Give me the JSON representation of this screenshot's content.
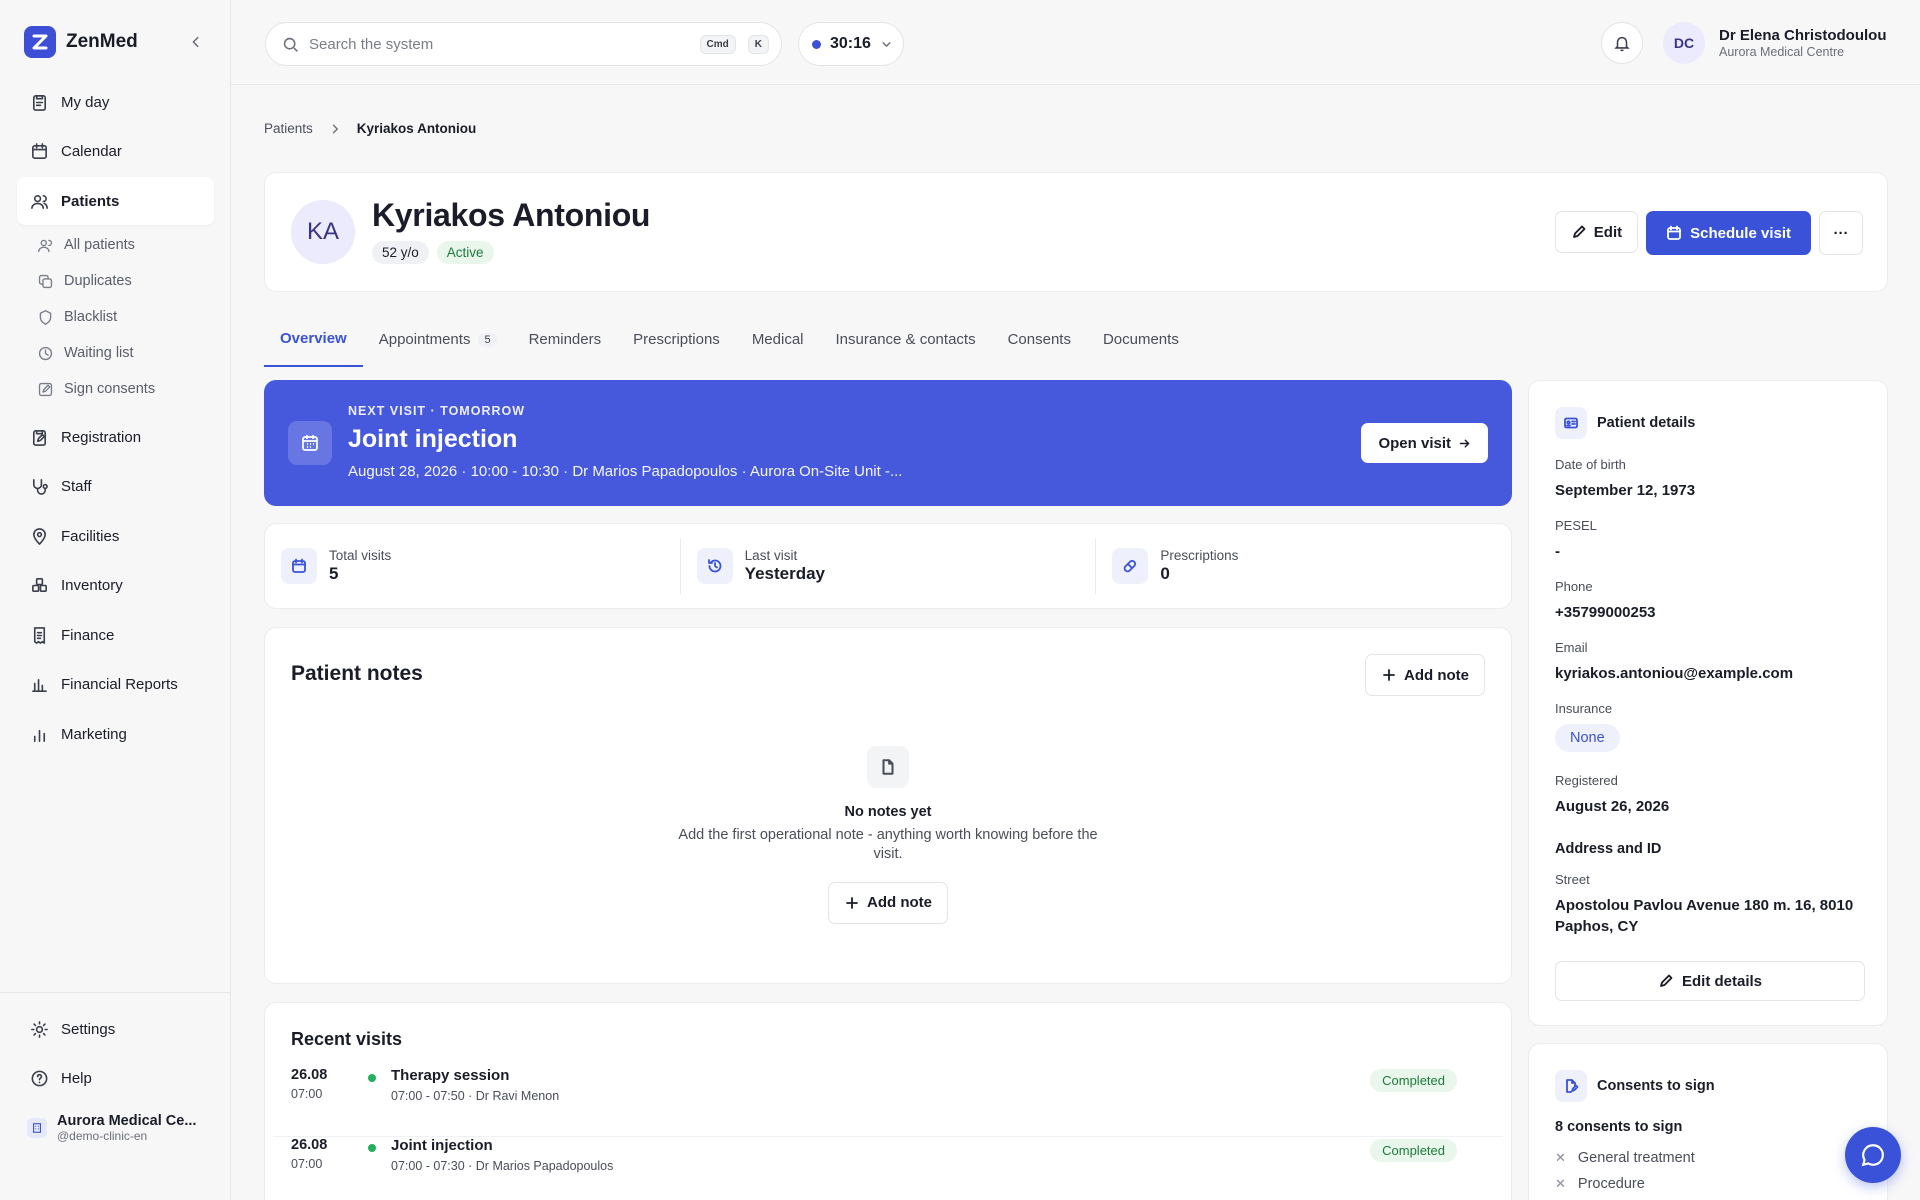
{
  "app": {
    "name": "ZenMed"
  },
  "sidebar": {
    "items": [
      {
        "label": "My day",
        "icon": "clipboard-icon"
      },
      {
        "label": "Calendar",
        "icon": "calendar-icon"
      },
      {
        "label": "Patients",
        "icon": "users-icon",
        "active": true
      },
      {
        "label": "Registration",
        "icon": "clipboard-edit-icon"
      },
      {
        "label": "Staff",
        "icon": "stethoscope-icon"
      },
      {
        "label": "Facilities",
        "icon": "map-pin-icon"
      },
      {
        "label": "Inventory",
        "icon": "boxes-icon"
      },
      {
        "label": "Finance",
        "icon": "receipt-icon"
      },
      {
        "label": "Financial Reports",
        "icon": "bar-chart-icon"
      },
      {
        "label": "Marketing",
        "icon": "signal-icon"
      }
    ],
    "patients_sub": [
      {
        "label": "All patients",
        "icon": "user-icon"
      },
      {
        "label": "Duplicates",
        "icon": "copy-icon"
      },
      {
        "label": "Blacklist",
        "icon": "shield-icon"
      },
      {
        "label": "Waiting list",
        "icon": "clock-icon"
      },
      {
        "label": "Sign consents",
        "icon": "pen-square-icon"
      }
    ],
    "settings_label": "Settings",
    "help_label": "Help",
    "clinic_name": "Aurora Medical Ce...",
    "clinic_handle": "@demo-clinic-en"
  },
  "topbar": {
    "search_placeholder": "Search the system",
    "shortcut_cmd": "Cmd",
    "shortcut_k": "K",
    "timer": "30:16",
    "user_initials": "DC",
    "user_name": "Dr Elena Christodoulou",
    "user_org": "Aurora Medical Centre"
  },
  "breadcrumb": {
    "parent": "Patients",
    "current": "Kyriakos Antoniou"
  },
  "patient": {
    "initials": "KA",
    "name": "Kyriakos Antoniou",
    "age": "52 y/o",
    "status": "Active",
    "edit_label": "Edit",
    "schedule_label": "Schedule visit",
    "more_label": "···"
  },
  "tabs": [
    {
      "label": "Overview",
      "active": true
    },
    {
      "label": "Appointments",
      "count": "5"
    },
    {
      "label": "Reminders"
    },
    {
      "label": "Prescriptions"
    },
    {
      "label": "Medical"
    },
    {
      "label": "Insurance & contacts"
    },
    {
      "label": "Consents"
    },
    {
      "label": "Documents"
    }
  ],
  "next_visit": {
    "label": "NEXT VISIT · TOMORROW",
    "title": "Joint injection",
    "meta": "August 28, 2026 · 10:00 - 10:30 · Dr Marios Papadopoulos · Aurora On-Site Unit -...",
    "button": "Open visit"
  },
  "stats": [
    {
      "label": "Total visits",
      "value": "5",
      "icon": "calendar-icon"
    },
    {
      "label": "Last visit",
      "value": "Yesterday",
      "icon": "history-icon"
    },
    {
      "label": "Prescriptions",
      "value": "0",
      "icon": "pill-icon"
    }
  ],
  "notes": {
    "title": "Patient notes",
    "add_label": "Add note",
    "empty_title": "No notes yet",
    "empty_desc": "Add the first operational note - anything worth knowing before the visit.",
    "empty_button": "Add note"
  },
  "recent": {
    "title": "Recent visits",
    "visits": [
      {
        "date": "26.08",
        "time": "07:00",
        "title": "Therapy session",
        "meta": "07:00 - 07:50 · Dr Ravi Menon",
        "status": "Completed"
      },
      {
        "date": "26.08",
        "time": "07:00",
        "title": "Joint injection",
        "meta": "07:00 - 07:30 · Dr Marios Papadopoulos",
        "status": "Completed"
      }
    ]
  },
  "details": {
    "title": "Patient details",
    "dob_label": "Date of birth",
    "dob": "September 12, 1973",
    "pesel_label": "PESEL",
    "pesel": "-",
    "phone_label": "Phone",
    "phone": "+35799000253",
    "email_label": "Email",
    "email": "kyriakos.antoniou@example.com",
    "insurance_label": "Insurance",
    "insurance": "None",
    "registered_label": "Registered",
    "registered": "August 26, 2026",
    "address_title": "Address and ID",
    "street_label": "Street",
    "street": "Apostolou Pavlou Avenue 180 m. 16, 8010 Paphos, CY",
    "edit_button": "Edit details"
  },
  "consents": {
    "title": "Consents to sign",
    "count": "8 consents to sign",
    "items": [
      "General treatment",
      "Procedure"
    ]
  },
  "colors": {
    "primary": "#3a52d8",
    "success": "#1f7a3a",
    "banner": "#4658dc"
  }
}
